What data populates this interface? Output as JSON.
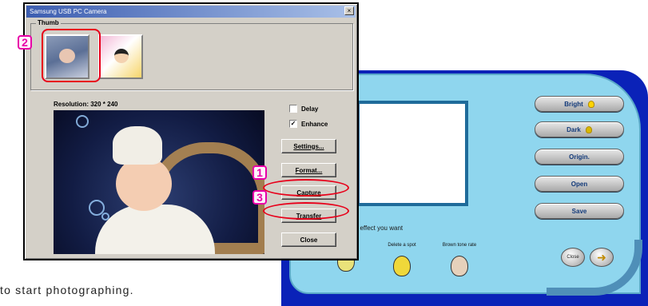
{
  "dialog": {
    "title": "Samsung USB PC Camera",
    "close_glyph": "×",
    "thumb_group_label": "Thumb",
    "resolution_text": "Resolution: 320 * 240",
    "delay": {
      "label": "Delay",
      "checked": false
    },
    "enhance": {
      "label": "Enhance",
      "checked": true,
      "check_glyph": "✓"
    },
    "buttons": {
      "settings": "Settings...",
      "format": "Format...",
      "capture": "Capture",
      "transfer": "Transfer",
      "close": "Close"
    }
  },
  "annotations": {
    "thumb_marker": "2",
    "capture_marker": "1",
    "transfer_marker": "3",
    "marker_color": "#e800a8",
    "highlight_color": "#e8001a"
  },
  "background_app": {
    "buttons": {
      "bright": "Bright",
      "dark": "Dark",
      "origin": "Origin.",
      "open": "Open",
      "save": "Save"
    },
    "effect_hint": "t effect you want",
    "effects": {
      "delete_spot": "Delete a spot",
      "brown_tone": "Brown tone rate"
    },
    "close_round_label": "Close",
    "next_icon": "arrow-right-icon",
    "colors": {
      "frame": "#0a22b8",
      "panel": "#8fd6ee"
    }
  },
  "caption": "to start photographing."
}
